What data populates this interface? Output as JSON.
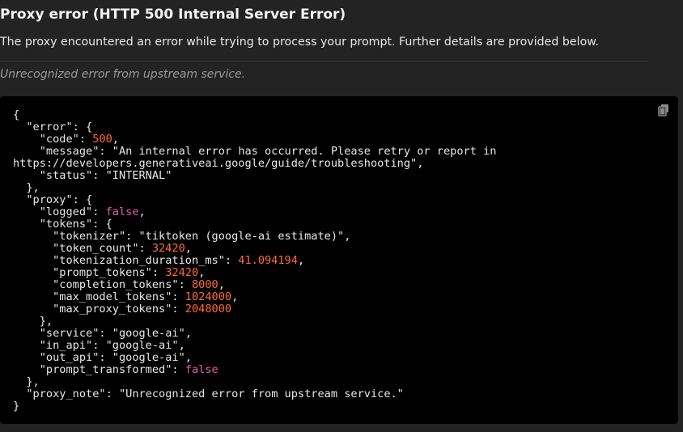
{
  "page": {
    "title": "Proxy error (HTTP 500 Internal Server Error)",
    "description": "The proxy encountered an error while trying to process your prompt. Further details are provided below.",
    "note": "Unrecognized error from upstream service."
  },
  "copy_icon": "copy-icon",
  "colors": {
    "background": "#232323",
    "code_background": "#000000",
    "number": "#ff6a3a",
    "boolean": "#e85aa8"
  },
  "error_json": {
    "error": {
      "code": "500",
      "message_part1": "\"An internal error has occurred. Please retry or report in",
      "message_part2": "https://developers.generativeai.google/guide/troubleshooting\"",
      "status": "\"INTERNAL\""
    },
    "proxy": {
      "logged": "false",
      "tokens": {
        "tokenizer": "\"tiktoken (google-ai estimate)\"",
        "token_count": "32420",
        "tokenization_duration_ms": "41.094194",
        "prompt_tokens": "32420",
        "completion_tokens": "8000",
        "max_model_tokens": "1024000",
        "max_proxy_tokens": "2048000"
      },
      "service": "\"google-ai\"",
      "in_api": "\"google-ai\"",
      "out_api": "\"google-ai\"",
      "prompt_transformed": "false"
    },
    "proxy_note": "\"Unrecognized error from upstream service.\""
  }
}
